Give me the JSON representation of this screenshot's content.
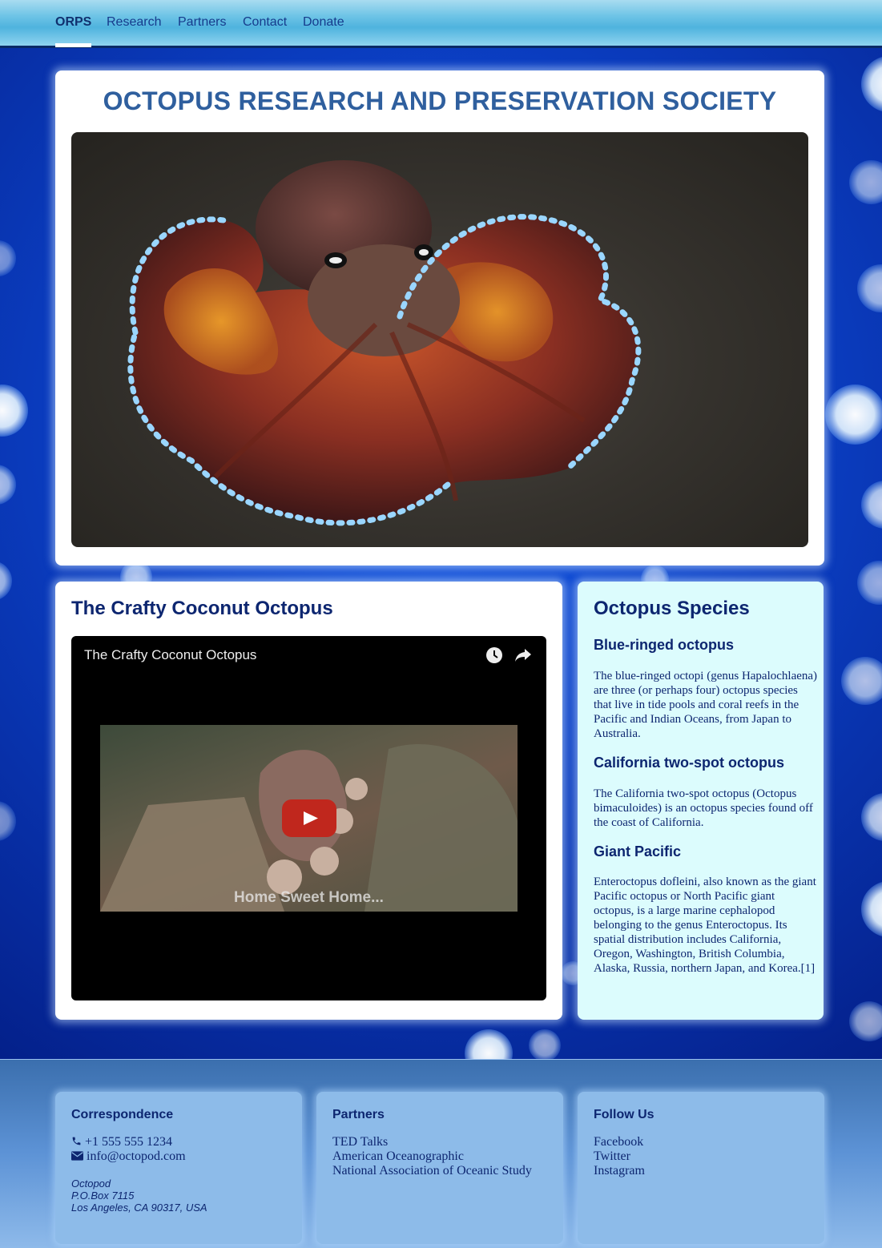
{
  "nav": {
    "brand": "ORPS",
    "items": [
      "Research",
      "Partners",
      "Contact",
      "Donate"
    ]
  },
  "hero": {
    "title": "OCTOPUS RESEARCH AND PRESERVATION SOCIETY"
  },
  "video_section": {
    "heading": "The Crafty Coconut Octopus",
    "video_title": "The Crafty Coconut Octopus",
    "thumbnail_caption": "Home Sweet Home...",
    "icons": [
      "clock-icon",
      "share-icon",
      "play-icon"
    ]
  },
  "species": {
    "heading": "Octopus Species",
    "items": [
      {
        "name": "Blue-ringed octopus",
        "text": "The blue-ringed octopi (genus Hapalochlaena) are three (or perhaps four) octopus species that live in tide pools and coral reefs in the Pacific and Indian Oceans, from Japan to Australia."
      },
      {
        "name": "California two-spot octopus",
        "text": "The California two-spot octopus (Octopus bimaculoides) is an octopus species found off the coast of California."
      },
      {
        "name": "Giant Pacific",
        "text": "Enteroctopus dofleini, also known as the giant Pacific octopus or North Pacific giant octopus, is a large marine cephalopod belonging to the genus Enteroctopus. Its spatial distribution includes California, Oregon, Washington, British Columbia, Alaska, Russia, northern Japan, and Korea.[1]"
      }
    ]
  },
  "footer": {
    "correspondence": {
      "heading": "Correspondence",
      "phone": "+1 555 555 1234",
      "email": "info@octopod.com",
      "address": [
        "Octopod",
        "P.O.Box 7115",
        "Los Angeles, CA 90317, USA"
      ]
    },
    "partners": {
      "heading": "Partners",
      "items": [
        "TED Talks",
        "American Oceanographic",
        "National Association of Oceanic Study"
      ]
    },
    "follow": {
      "heading": "Follow Us",
      "items": [
        "Facebook",
        "Twitter",
        "Instagram"
      ]
    }
  },
  "colors": {
    "heading": "#0d2670",
    "hero_title": "#2f5f9e",
    "species_bg": "#dcfcfd",
    "play_button": "#c0271d"
  }
}
